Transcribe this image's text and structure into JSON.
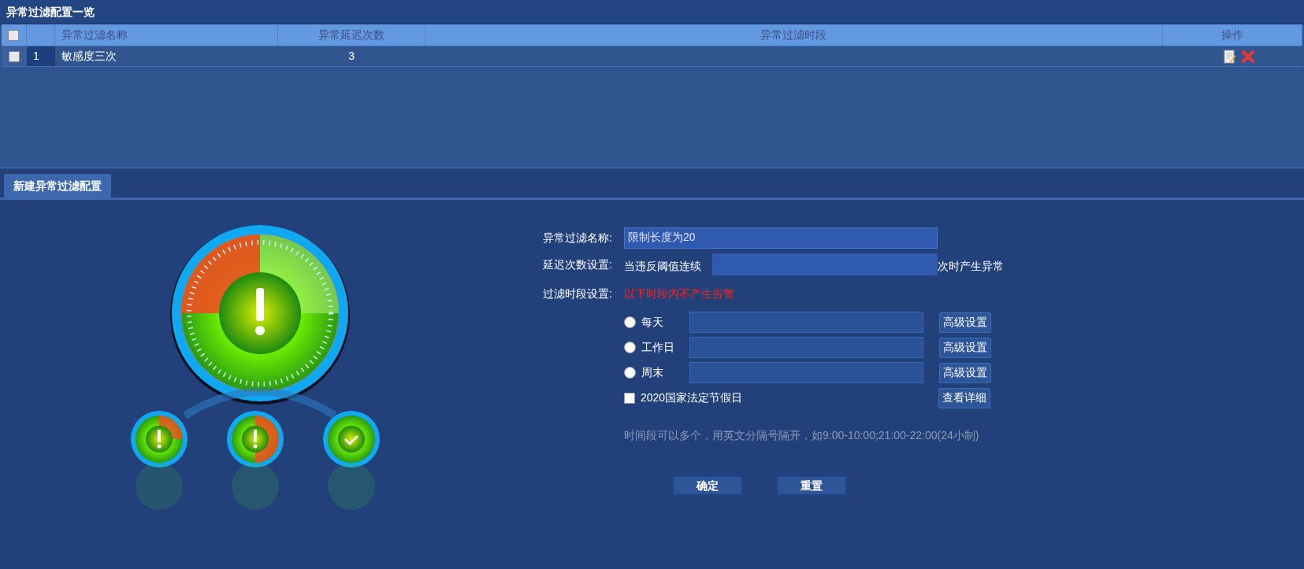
{
  "panel_title": "异常过滤配置一览",
  "table": {
    "header_checked": false,
    "columns": [
      "异常过滤名称",
      "异常延迟次数",
      "异常过滤时段",
      "操作"
    ],
    "rows": [
      {
        "checked": false,
        "index": "1",
        "name": "敏感度三次",
        "count": "3",
        "period": ""
      }
    ]
  },
  "tabs": [
    {
      "label": "新建异常过滤配置",
      "selected": true
    }
  ],
  "form": {
    "name_label": "异常过滤名称:",
    "name_value": "限制长度为20",
    "delay_label": "延迟次数设置:",
    "delay_prefix": "当违反阈值连续",
    "delay_suffix": "次时产生异常",
    "period_label": "过滤时段设置:",
    "period_note": "以下时段内不产生告警",
    "options": [
      {
        "kind": "radio",
        "label": "每天",
        "selected": false,
        "button": "高级设置"
      },
      {
        "kind": "radio",
        "label": "工作日",
        "selected": false,
        "button": "高级设置"
      },
      {
        "kind": "radio",
        "label": "周末",
        "selected": false,
        "button": "高级设置"
      },
      {
        "kind": "checkbox",
        "label": "2020国家法定节假日",
        "checked": false,
        "button": "查看详细"
      }
    ],
    "hint": "时间段可以多个，用英文分隔号隔开，如9:00-10:00;21:00-22:00(24小制)",
    "buttons": [
      "确定",
      "重置"
    ]
  }
}
